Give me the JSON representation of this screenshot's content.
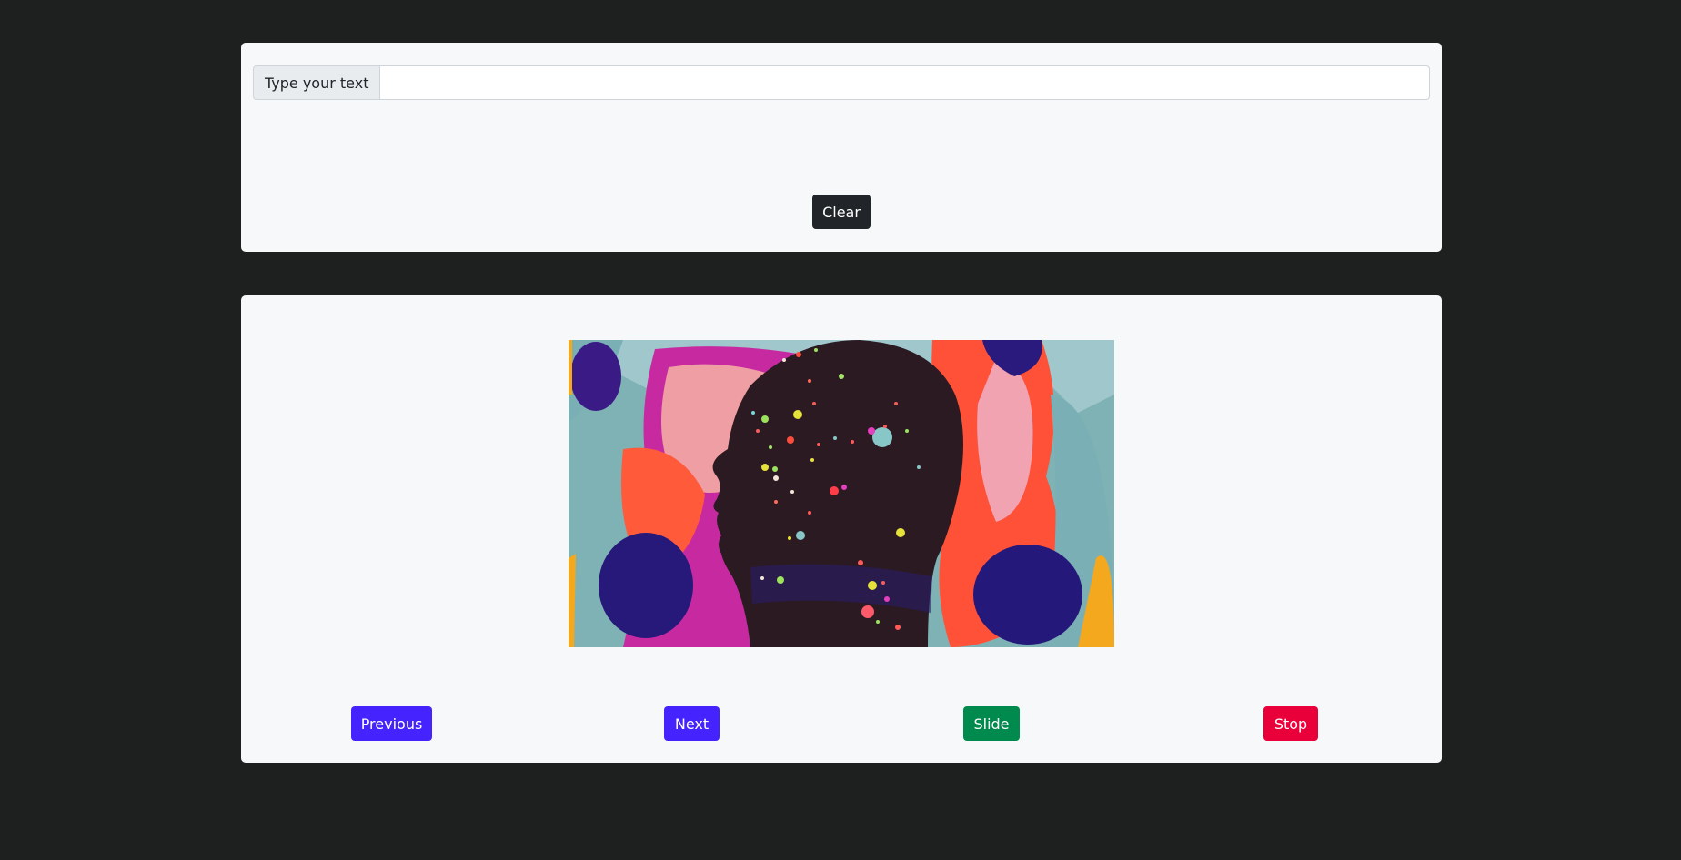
{
  "text_form": {
    "label": "Type your text",
    "input_value": "",
    "input_placeholder": "",
    "clear_label": "Clear"
  },
  "slideshow": {
    "image_icon": "head-silhouette-artwork",
    "controls": {
      "previous_label": "Previous",
      "next_label": "Next",
      "slide_label": "Slide",
      "stop_label": "Stop"
    }
  },
  "colors": {
    "page_background": "#1e1f1f",
    "card_background": "#f7f8f9",
    "clear_button": "#212529",
    "previous_button": "#4423ff",
    "next_button": "#4423ff",
    "slide_button": "#008a4e",
    "stop_button": "#e9003a"
  }
}
